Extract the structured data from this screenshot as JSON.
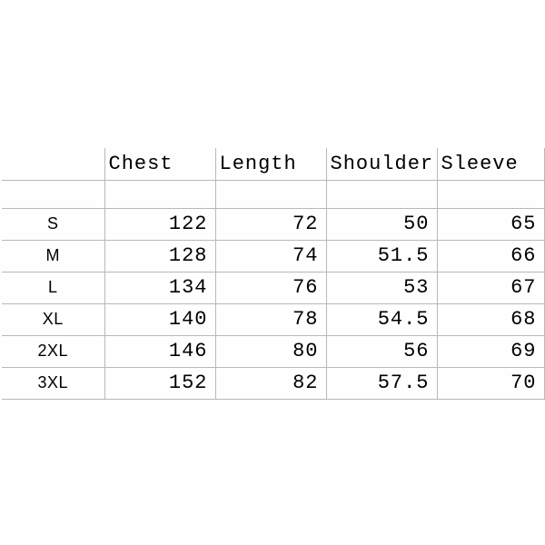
{
  "chart_data": {
    "type": "table",
    "headers": [
      "",
      "Chest",
      "Length",
      "Shoulder",
      "Sleeve"
    ],
    "rows": [
      [
        "S",
        122,
        72,
        50,
        65
      ],
      [
        "M",
        128,
        74,
        51.5,
        66
      ],
      [
        "L",
        134,
        76,
        53,
        67
      ],
      [
        "XL",
        140,
        78,
        54.5,
        68
      ],
      [
        "2XL",
        146,
        80,
        56,
        69
      ],
      [
        "3XL",
        152,
        82,
        57.5,
        70
      ]
    ]
  }
}
